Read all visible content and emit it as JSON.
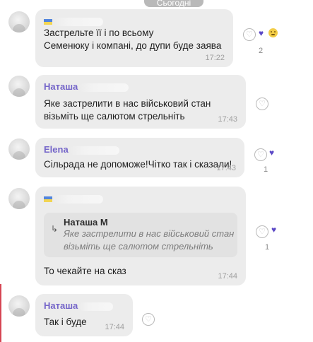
{
  "date_label": "Сьогодні",
  "messages": [
    {
      "sender": "",
      "text_lines": [
        "Застрельте її і по всьому",
        "Семенюку і компані, до дупи буде заява"
      ],
      "time": "17:22",
      "reactions": [
        "heart-outline",
        "purple-heart",
        "smile-emoji"
      ],
      "count": "2"
    },
    {
      "sender": "Наташа",
      "text_lines": [
        "Яке застрелити в нас військовий стан",
        "візьміть ще салютом стрельніть"
      ],
      "time": "17:43",
      "reactions": [
        "heart-outline"
      ]
    },
    {
      "sender": "Elena",
      "text_lines": [
        "Сільрада не допоможе!Чітко так і сказали!"
      ],
      "time": "17:43",
      "reactions": [
        "heart-outline",
        "purple-heart"
      ],
      "count": "1"
    },
    {
      "sender": "",
      "reply": {
        "name": "Наташа М",
        "text_lines": [
          "Яке застрелити в нас військовий стан",
          "візьміть ще салютом стрельніть"
        ]
      },
      "text_lines": [
        "То чекайте на сказ"
      ],
      "time": "17:44",
      "reactions": [
        "heart-outline",
        "purple-heart"
      ],
      "count": "1"
    },
    {
      "sender": "Наташа",
      "text_lines": [
        "Так і буде"
      ],
      "time": "17:44",
      "reactions": [
        "heart-outline"
      ]
    }
  ]
}
